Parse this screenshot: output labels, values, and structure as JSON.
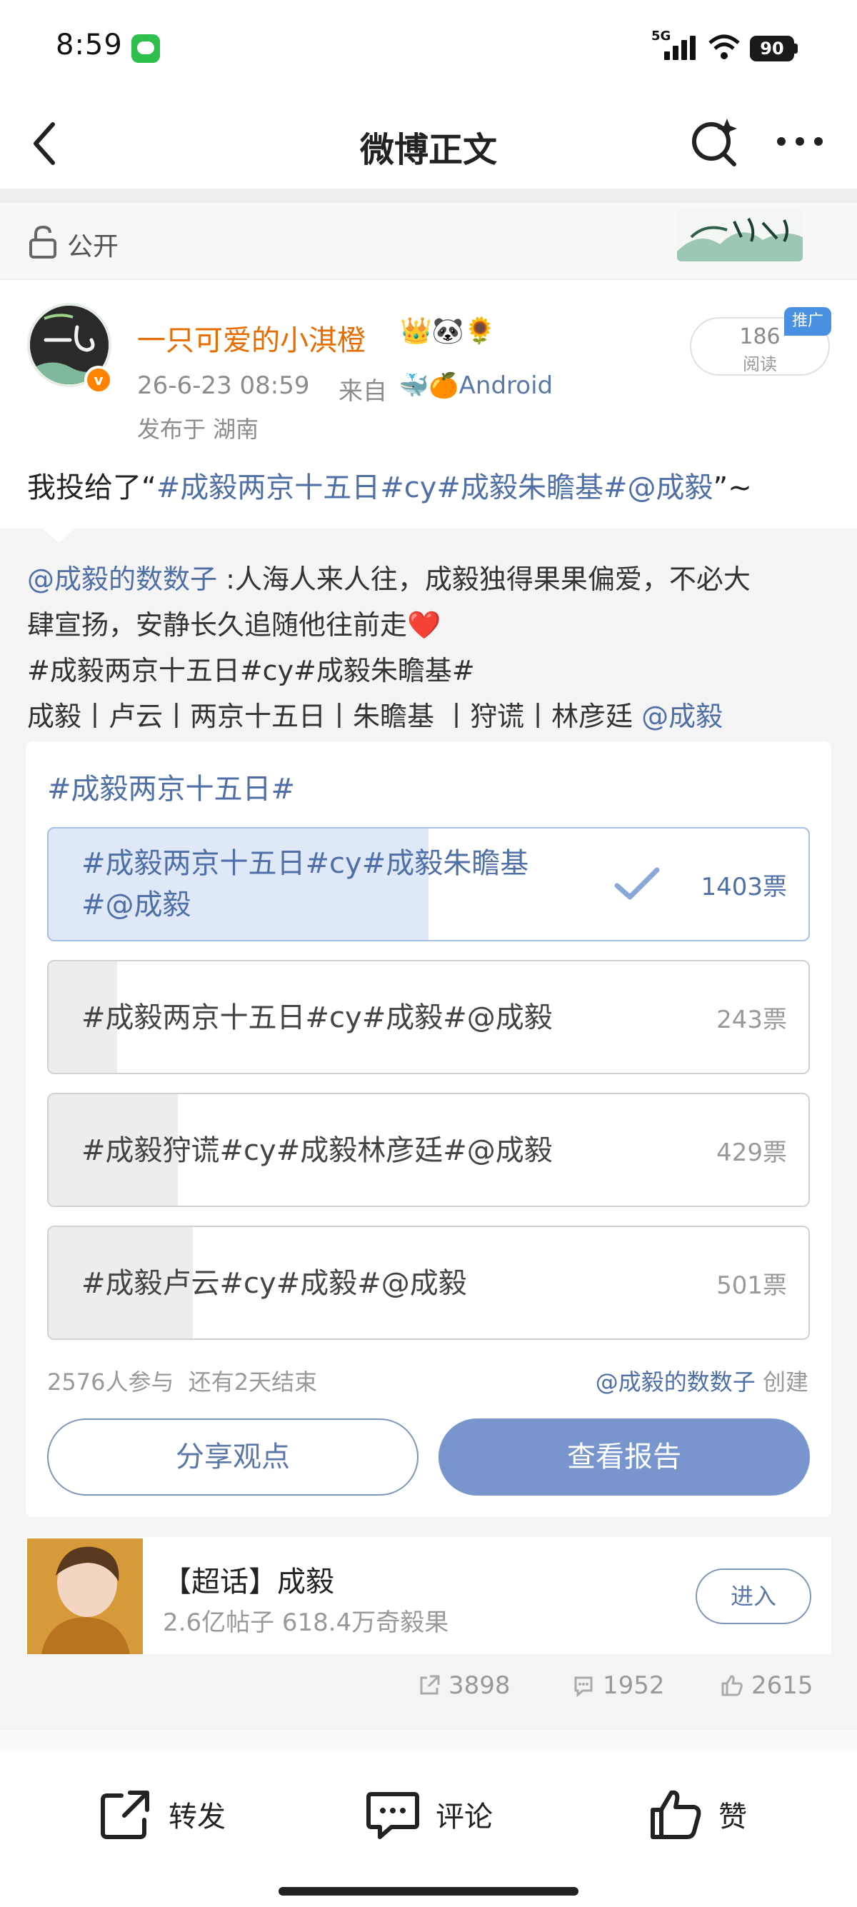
{
  "status_bar": {
    "time": "8:59",
    "network": "5G",
    "battery": "90"
  },
  "nav": {
    "title": "微博正文"
  },
  "visibility": {
    "label": "公开"
  },
  "author": {
    "name": "一只可爱的小淇橙",
    "emojis": "👑🐼🌻",
    "time": "26-6-23 08:59",
    "from_label": "来自",
    "device": "🐳🍊Android",
    "location": "发布于 湖南",
    "read_count": "186",
    "read_label": "阅读",
    "ad_label": "推广"
  },
  "post": {
    "prefix": "我投给了“",
    "hashtags": "#成毅两京十五日#cy#成毅朱瞻基#@成毅",
    "suffix": "”~"
  },
  "quote": {
    "mention": "@成毅的数数子",
    "line1_text": " :人海人来人往，成毅独得果果偏爱，不必大",
    "line2": "肆宣扬，安静长久追随他往前走❤️",
    "line3": "#成毅两京十五日#cy#成毅朱瞻基#",
    "line4_text": "成毅丨卢云丨两京十五日丨朱瞻基 丨狩谎丨林彦廷 ",
    "line4_mention": "@成毅"
  },
  "poll": {
    "title": "#成毅两京十五日#",
    "options": [
      {
        "text_line1": "#成毅两京十五日#cy#成毅朱瞻基",
        "text_line2": "#@成毅",
        "votes": "1403票",
        "share": 0.5,
        "selected": true
      },
      {
        "text_line1": "#成毅两京十五日#cy#成毅#@成毅",
        "text_line2": "",
        "votes": "243票",
        "share": 0.09,
        "selected": false
      },
      {
        "text_line1": "#成毅狩谎#cy#成毅林彦廷#@成毅",
        "text_line2": "",
        "votes": "429票",
        "share": 0.17,
        "selected": false
      },
      {
        "text_line1": "#成毅卢云#cy#成毅#@成毅",
        "text_line2": "",
        "votes": "501票",
        "share": 0.19,
        "selected": false
      }
    ],
    "participants": "2576人参与",
    "remaining": "还有2天结束",
    "creator_mention": "@成毅的数数子",
    "creator_suffix": " 创建",
    "share_label": "分享观点",
    "report_label": "查看报告"
  },
  "topic": {
    "title": "【超话】成毅",
    "stats": "2.6亿帖子 618.4万奇毅果",
    "enter_label": "进入"
  },
  "stats": {
    "reposts": "3898",
    "comments": "1952",
    "likes": "2615"
  },
  "bottom_bar": {
    "repost": "转发",
    "comment": "评论",
    "like": "赞"
  },
  "colors": {
    "link": "#4f6fa6",
    "username": "#e86d00",
    "primary_button": "#7896cd"
  },
  "icons": [
    "back-icon",
    "search-spark-icon",
    "more-icon",
    "lock-icon",
    "check-icon",
    "repost-icon",
    "comment-icon",
    "like-icon"
  ]
}
